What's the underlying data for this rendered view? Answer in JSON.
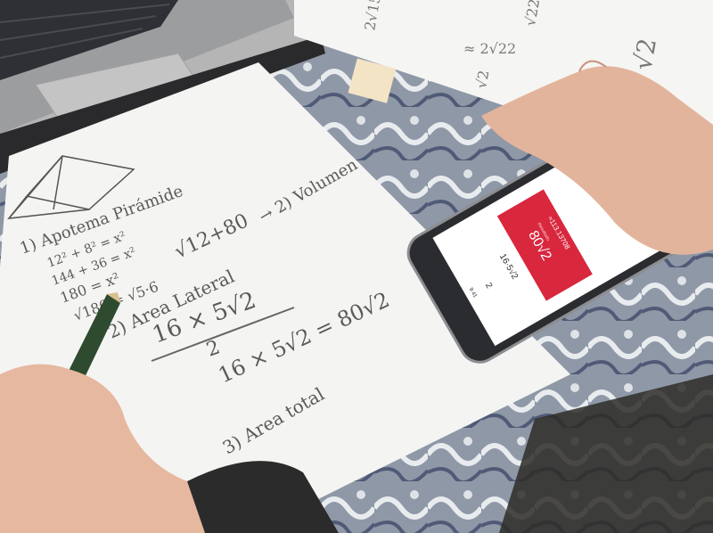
{
  "scene": {
    "description_tags": [
      "laptop",
      "paper",
      "pencil",
      "smartphone",
      "hands"
    ]
  },
  "paper_notes": {
    "line1": "1) Apotema Pirámide",
    "eq1": "12² + 8² = x²",
    "eq2": "144 + 36 = x²",
    "eq3": "180 = x²",
    "eq4": "√180 = √5·6",
    "line2": "2) Area Lateral",
    "frac_num": "16 × 5√2",
    "frac_den": "2",
    "result": "16 × 5√2 = 80√2",
    "line3": "3) Area total",
    "side_note": "→ 2) Volumen",
    "sqrt_expr": "√12+80"
  },
  "phone": {
    "status_time": "9:41",
    "expression_top": "2",
    "input_expr": "16·5√2",
    "result_exact": "80√2",
    "result_decimal": "≈113.13708",
    "result_label": "Resultado"
  },
  "colors": {
    "paper": "#f4f4f2",
    "phone_body": "#2b2c30",
    "result_red": "#d9273e",
    "laptop": "#a9a9a9",
    "skin": "#e6b8a0"
  }
}
